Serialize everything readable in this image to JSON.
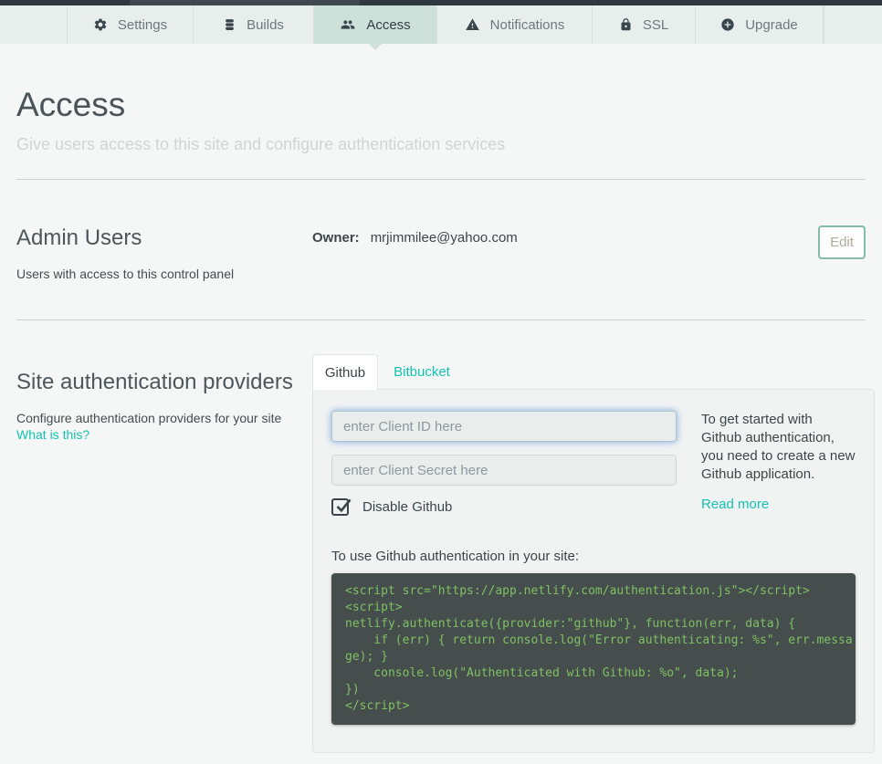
{
  "topnav": {
    "tabs": [
      {
        "label": "Settings",
        "icon": "gear",
        "active": false
      },
      {
        "label": "Builds",
        "icon": "stack",
        "active": false
      },
      {
        "label": "Access",
        "icon": "people",
        "active": true
      },
      {
        "label": "Notifications",
        "icon": "warning",
        "active": false
      },
      {
        "label": "SSL",
        "icon": "lock",
        "active": false
      },
      {
        "label": "Upgrade",
        "icon": "plus-circle",
        "active": false
      }
    ]
  },
  "page": {
    "title": "Access",
    "subtitle": "Give users access to this site and configure authentication services"
  },
  "admin_users": {
    "title": "Admin Users",
    "description": "Users with access to this control panel",
    "owner_label": "Owner:",
    "owner_email": "mrjimmilee@yahoo.com",
    "edit_label": "Edit"
  },
  "auth_providers": {
    "title": "Site authentication providers",
    "description": "Configure authentication providers for your site",
    "help_link": "What is this?",
    "tabs": [
      {
        "label": "Github",
        "active": true
      },
      {
        "label": "Bitbucket",
        "active": false
      }
    ],
    "github": {
      "client_id_placeholder": "enter Client ID here",
      "client_secret_placeholder": "enter Client Secret here",
      "disable_label": "Disable Github",
      "disable_checked": true,
      "sidebar_text": "To get started with Github authentication, you need to create a new Github application.",
      "read_more_label": "Read more",
      "usage_intro": "To use Github authentication in your site:",
      "code": "<script src=\"https://app.netlify.com/authentication.js\"></script>\n<script>\nnetlify.authenticate({provider:\"github\"}, function(err, data) {\n    if (err) { return console.log(\"Error authenticating: %s\", err.messa\nge); }\n    console.log(\"Authenticated with Github: %o\", data);\n})\n</script>"
    }
  },
  "colors": {
    "accent_teal": "#13c2b2",
    "active_tab_bg": "#cee0da",
    "edit_button_border": "#84bba9",
    "code_background": "#454d4d",
    "code_text": "#7fc162"
  }
}
